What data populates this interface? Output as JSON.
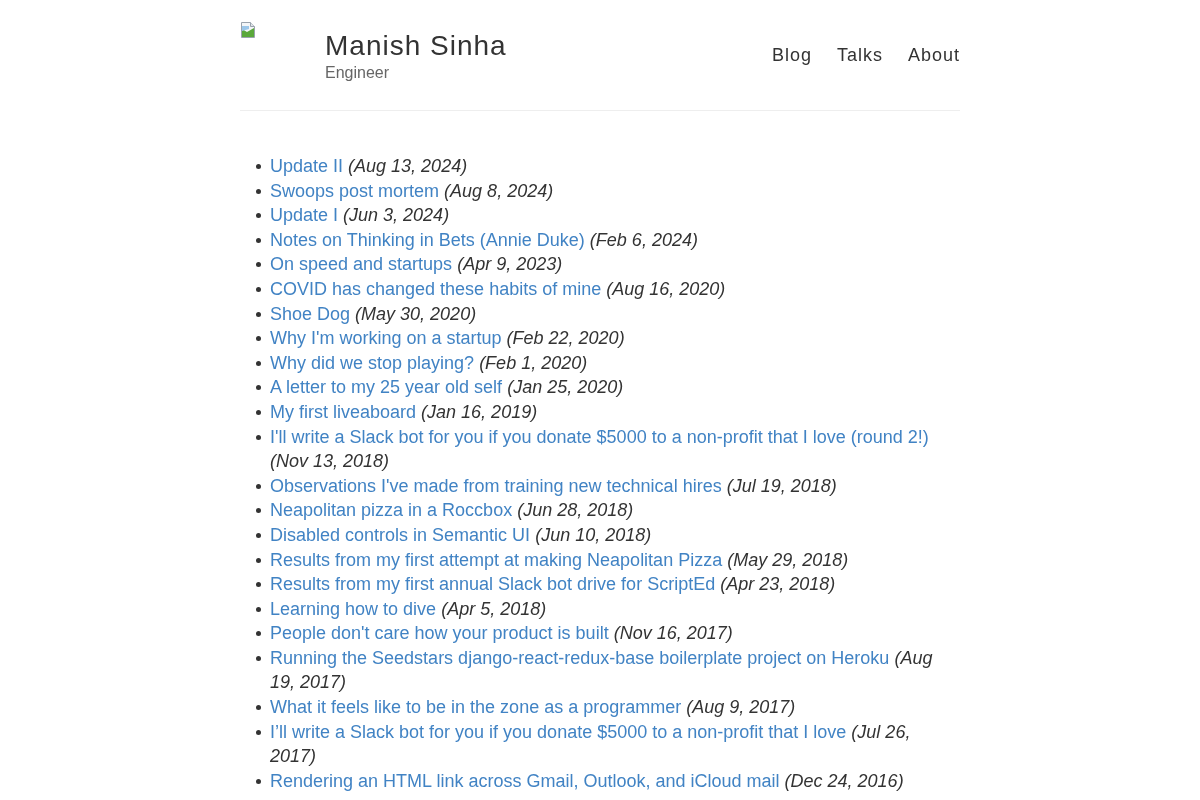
{
  "header": {
    "site_title": "Manish Sinha",
    "tagline": "Engineer",
    "nav": [
      {
        "label": "Blog"
      },
      {
        "label": "Talks"
      },
      {
        "label": "About"
      }
    ]
  },
  "posts": [
    {
      "title": "Update II",
      "date": "(Aug 13, 2024)"
    },
    {
      "title": "Swoops post mortem",
      "date": "(Aug 8, 2024)"
    },
    {
      "title": "Update I",
      "date": "(Jun 3, 2024)"
    },
    {
      "title": "Notes on Thinking in Bets (Annie Duke)",
      "date": "(Feb 6, 2024)"
    },
    {
      "title": "On speed and startups",
      "date": "(Apr 9, 2023)"
    },
    {
      "title": "COVID has changed these habits of mine",
      "date": "(Aug 16, 2020)"
    },
    {
      "title": "Shoe Dog",
      "date": "(May 30, 2020)"
    },
    {
      "title": "Why I'm working on a startup",
      "date": "(Feb 22, 2020)"
    },
    {
      "title": "Why did we stop playing?",
      "date": "(Feb 1, 2020)"
    },
    {
      "title": "A letter to my 25 year old self",
      "date": "(Jan 25, 2020)"
    },
    {
      "title": "My first liveaboard",
      "date": "(Jan 16, 2019)"
    },
    {
      "title": "I'll write a Slack bot for you if you donate $5000 to a non-profit that I love (round 2!)",
      "date": "(Nov 13, 2018)"
    },
    {
      "title": "Observations I've made from training new technical hires",
      "date": "(Jul 19, 2018)"
    },
    {
      "title": "Neapolitan pizza in a Roccbox",
      "date": "(Jun 28, 2018)"
    },
    {
      "title": "Disabled controls in Semantic UI",
      "date": "(Jun 10, 2018)"
    },
    {
      "title": "Results from my first attempt at making Neapolitan Pizza",
      "date": "(May 29, 2018)"
    },
    {
      "title": "Results from my first annual Slack bot drive for ScriptEd",
      "date": "(Apr 23, 2018)"
    },
    {
      "title": "Learning how to dive",
      "date": "(Apr 5, 2018)"
    },
    {
      "title": "People don't care how your product is built",
      "date": "(Nov 16, 2017)"
    },
    {
      "title": "Running the Seedstars django-react-redux-base boilerplate project on Heroku",
      "date": "(Aug 19, 2017)"
    },
    {
      "title": "What it feels like to be in the zone as a programmer",
      "date": "(Aug 9, 2017)"
    },
    {
      "title": "I’ll write a Slack bot for you if you donate $5000 to a non-profit that I love",
      "date": "(Jul 26, 2017)"
    },
    {
      "title": "Rendering an HTML link across Gmail, Outlook, and iCloud mail",
      "date": "(Dec 24, 2016)"
    }
  ]
}
